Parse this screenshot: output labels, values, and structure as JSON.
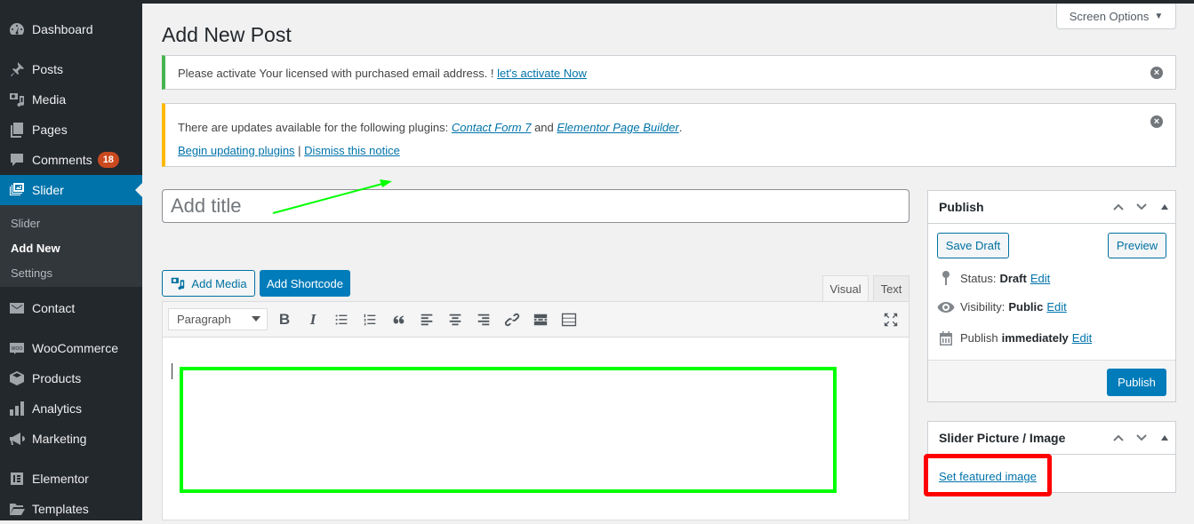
{
  "sidebar": {
    "items": [
      {
        "id": "dashboard",
        "label": "Dashboard",
        "icon": "dashboard-icon"
      },
      {
        "id": "posts",
        "label": "Posts",
        "icon": "pin-icon"
      },
      {
        "id": "media",
        "label": "Media",
        "icon": "media-icon"
      },
      {
        "id": "pages",
        "label": "Pages",
        "icon": "pages-icon"
      },
      {
        "id": "comments",
        "label": "Comments",
        "icon": "comment-icon",
        "badge": "18"
      },
      {
        "id": "slider",
        "label": "Slider",
        "icon": "slider-icon",
        "active": true
      },
      {
        "id": "contact",
        "label": "Contact",
        "icon": "envelope-icon"
      },
      {
        "id": "woocommerce",
        "label": "WooCommerce",
        "icon": "woo-icon"
      },
      {
        "id": "products",
        "label": "Products",
        "icon": "box-icon"
      },
      {
        "id": "analytics",
        "label": "Analytics",
        "icon": "bar-chart-icon"
      },
      {
        "id": "marketing",
        "label": "Marketing",
        "icon": "megaphone-icon"
      },
      {
        "id": "elementor",
        "label": "Elementor",
        "icon": "elementor-icon"
      },
      {
        "id": "templates",
        "label": "Templates",
        "icon": "folder-icon"
      }
    ],
    "submenu": [
      "Slider",
      "Add New",
      "Settings"
    ],
    "submenu_current": "Add New"
  },
  "header": {
    "screen_options": "Screen Options",
    "page_title": "Add New Post"
  },
  "notices": {
    "license": {
      "text": "Please activate Your licensed with purchased email address. ! ",
      "link": "let's activate Now",
      "accent": "#46b450"
    },
    "updates": {
      "text_before": "There are updates available for the following plugins: ",
      "plugin1": "Contact Form 7",
      "joiner": " and ",
      "plugin2": "Elementor Page Builder",
      "text_after": ".",
      "action1": "Begin updating plugins",
      "separator": " | ",
      "action2": "Dismiss this notice",
      "accent": "#ffb900"
    }
  },
  "editor": {
    "title_placeholder": "Add title",
    "title_value": "",
    "add_media": "Add Media",
    "add_shortcode": "Add Shortcode",
    "tabs": [
      "Visual",
      "Text"
    ],
    "active_tab": "Visual",
    "format_select": "Paragraph",
    "toolbar": [
      "bold",
      "italic",
      "bulleted-list",
      "numbered-list",
      "blockquote",
      "align-left",
      "align-center",
      "align-right",
      "insert-link",
      "read-more",
      "toolbar-toggle",
      "fullscreen"
    ]
  },
  "publish_box": {
    "title": "Publish",
    "save_draft": "Save Draft",
    "preview": "Preview",
    "status_label": "Status:",
    "status_value": "Draft",
    "visibility_label": "Visibility:",
    "visibility_value": "Public",
    "schedule_label": "Publish",
    "schedule_value": "immediately",
    "edit": "Edit",
    "publish": "Publish"
  },
  "featured_box": {
    "title": "Slider Picture / Image",
    "link": "Set featured image"
  },
  "colors": {
    "primary": "#0073aa",
    "sidebar_bg": "#23282d",
    "badge": "#ca4a1f",
    "annotation_green": "#00ff00",
    "annotation_red": "#ff0000"
  }
}
